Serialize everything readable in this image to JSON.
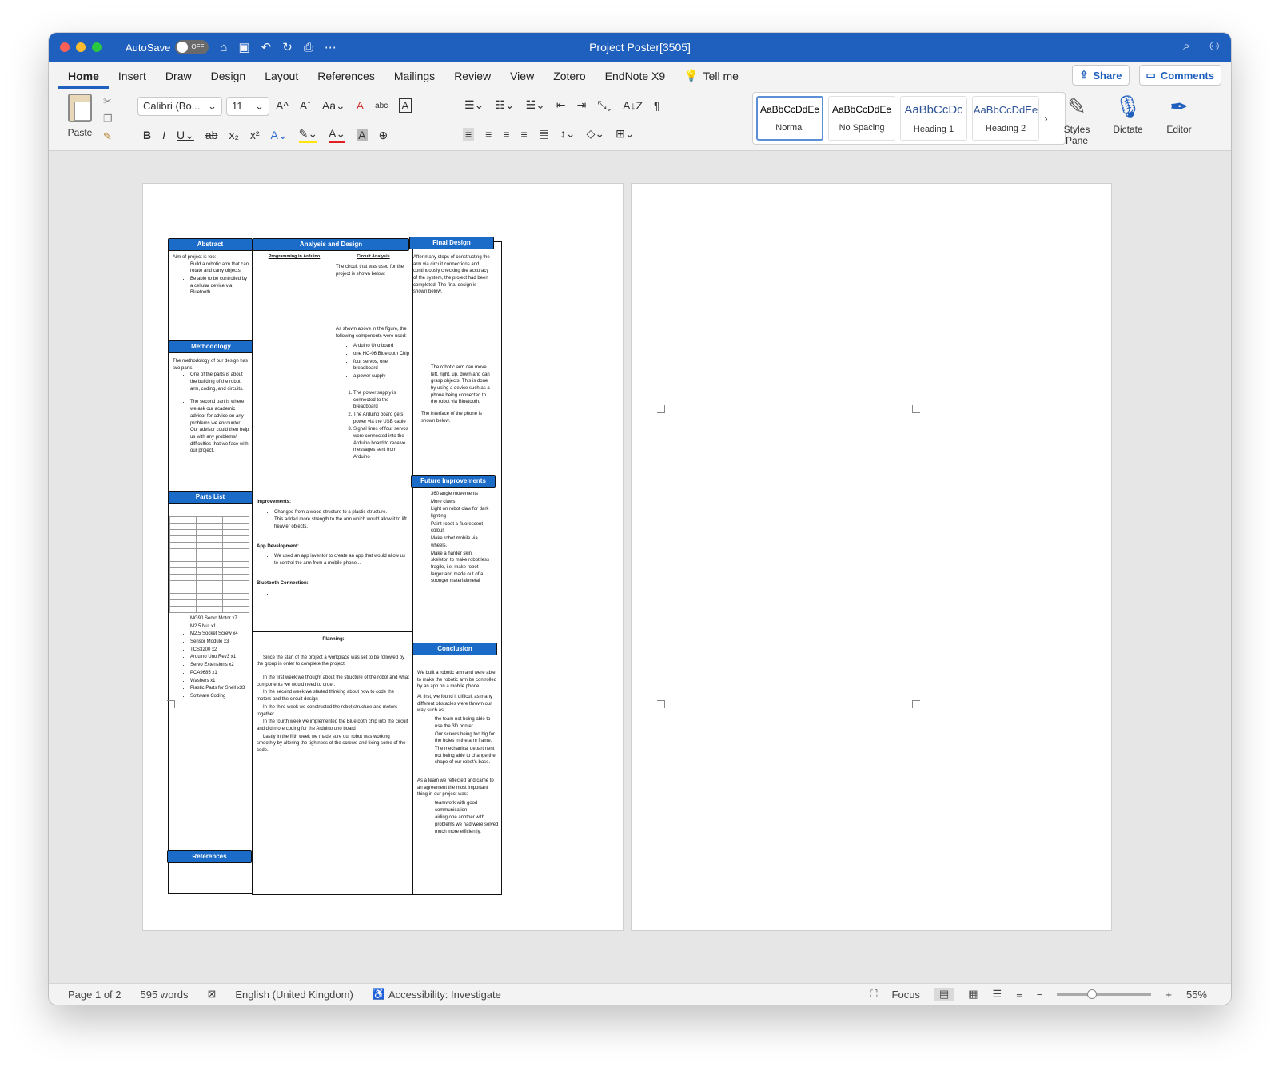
{
  "titlebar": {
    "autosave_label": "AutoSave",
    "autosave_state": "OFF",
    "doc_title": "Project Poster[3505]"
  },
  "tabs": [
    "Home",
    "Insert",
    "Draw",
    "Design",
    "Layout",
    "References",
    "Mailings",
    "Review",
    "View",
    "Zotero",
    "EndNote X9"
  ],
  "tell_me": "Tell me",
  "share_label": "Share",
  "comments_label": "Comments",
  "ribbon": {
    "paste_label": "Paste",
    "font_name": "Calibri (Bo...",
    "font_size": "11",
    "styles": [
      {
        "preview": "AaBbCcDdEe",
        "name": "Normal"
      },
      {
        "preview": "AaBbCcDdEe",
        "name": "No Spacing"
      },
      {
        "preview": "AaBbCcDc",
        "name": "Heading 1"
      },
      {
        "preview": "AaBbCcDdEe",
        "name": "Heading 2"
      }
    ],
    "styles_pane_label": "Styles Pane",
    "dictate_label": "Dictate",
    "editor_label": "Editor"
  },
  "status": {
    "page": "Page 1 of 2",
    "words": "595 words",
    "language": "English (United Kingdom)",
    "accessibility": "Accessibility: Investigate",
    "focus": "Focus",
    "zoom": "55%"
  },
  "poster": {
    "abstract": {
      "heading": "Abstract",
      "intro": "Aim of project is too:",
      "bullets": [
        "Build a robotic arm that can rotate and carry objects",
        "Be able to be controlled by a cellular device via Bluetooth."
      ]
    },
    "methodology": {
      "heading": "Methodology",
      "intro": "The methodology of our design has two parts.",
      "bullets": [
        "One of the parts is about the building of the robot arm, coding, and circuits.",
        "The second part is where we ask our academic advisor for advice on any problems we encounter. Our advisor could then help us with any problems/ difficulties that we face with our project."
      ]
    },
    "parts": {
      "heading": "Parts List",
      "items": [
        "MG90 Servo Motor x7",
        "M2.5 Nut x1",
        "M2.5 Socket Screw x4",
        "Sensor Module x3",
        "TCS3200 x2",
        "Arduino Uno Rev3 x1",
        "Servo Extensions x2",
        "PCA9685 x1",
        "Washers x1",
        "Plastic Parts for Shell x33",
        "Software Coding"
      ]
    },
    "references": {
      "heading": "References"
    },
    "analysis": {
      "heading": "Analysis and Design",
      "programming_title": "Programming in Arduino",
      "circuit_title": "Circuit Analysis",
      "circuit_intro": "The circuit that was used for the project is shown below:",
      "components_intro": "As shown above in the figure, the following components were used:",
      "components": [
        "Arduino Uno board",
        "one HC-06 Bluetooth Chip",
        "four servos, one breadboard",
        "a power supply"
      ],
      "steps": [
        "The power supply is connected to the breadboard",
        "The Arduino board gets power via the USB cable",
        "Signal lines of four servos were connected into the Arduino board to receive messages sent from Arduino"
      ]
    },
    "improvements": {
      "title": "Improvements:",
      "bullets": [
        "Changed from a wood structure to a plastic structure.",
        "This added more strength to the arm which would allow it to lift heavier objects."
      ],
      "app_title": "App Development:",
      "app_bullets": [
        "We used an app inventor to create an app that would allow us to control the arm from a mobile phone..."
      ],
      "bt_title": "Bluetooth Connection:"
    },
    "planning": {
      "title": "Planning:",
      "bullets": [
        "Since the start of the project a workplace was set to be followed by the group in order to complete the project.",
        "In the first week we thought about the structure of the robot and what components we would need to order.",
        "In the second week we started thinking about how to code the motors and the circuit design",
        "In the third week we constructed the robot structure and motors together",
        "In the fourth week we implemented the Bluetooth chip into the circuit and did more coding for the Arduino uno board",
        "Lastly in the fifth week we made sure our robot was working smoothly by altering the tightness of the screws and fixing some of the code."
      ]
    },
    "final_design": {
      "heading": "Final Design",
      "intro": "After many steps of constructing the arm via circuit connections and continuously checking the accuracy of the system, the project had been completed. The final design is shown below.",
      "bullets": [
        "The robotic arm can move left, right, up, down and can grasp objects. This is done by using a device such as a phone being connected to the robot via Bluetooth."
      ],
      "interface": "The interface of the phone is shown below."
    },
    "future": {
      "heading": "Future Improvements",
      "bullets": [
        "360 angle movements",
        "More claws",
        "Light on robot claw for dark lighting",
        "Paint robot a fluorescent colour.",
        "Make robot mobile via wheels.",
        "Make a harder skin, skeleton to make robot less fragile, i.e. make robot larger and made out of a stronger material/metal"
      ]
    },
    "conclusion": {
      "heading": "Conclusion",
      "intro": "We built a robotic arm and were able to make the robotic arm be controlled by an app on a mobile phone.",
      "obstacles_intro": "At first, we found it difficult as many different obstacles were thrown our way such as:",
      "obstacles": [
        "the team not being able to use the 3D printer.",
        "Our screws being too big for the holes in the arm frame.",
        "The mechanical department not being able to change the shape of our robot's base."
      ],
      "reflect": "As a team we reflected and came to an agreement the most important thing in our project was:",
      "lessons": [
        "teamwork with good communication",
        "aiding one another with problems we had were solved much more efficiently."
      ]
    }
  }
}
